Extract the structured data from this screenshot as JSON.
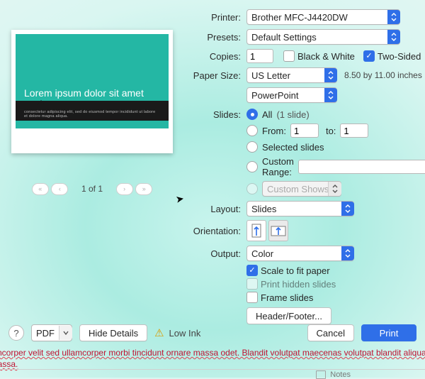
{
  "labels": {
    "printer": "Printer:",
    "presets": "Presets:",
    "copies": "Copies:",
    "paperSize": "Paper Size:",
    "slides": "Slides:",
    "layout": "Layout:",
    "orientation": "Orientation:",
    "output": "Output:"
  },
  "printer": {
    "value": "Brother MFC-J4420DW"
  },
  "presets": {
    "value": "Default Settings"
  },
  "copies": {
    "value": "1",
    "bw": {
      "label": "Black & White",
      "checked": false
    },
    "twoSided": {
      "label": "Two-Sided",
      "checked": true
    }
  },
  "paperSize": {
    "value": "US Letter",
    "dims": "8.50 by 11.00 inches"
  },
  "app": {
    "value": "PowerPoint"
  },
  "slides": {
    "all": {
      "label": "All",
      "count": "(1 slide)"
    },
    "from": {
      "label": "From:",
      "start": "1",
      "toLabel": "to:",
      "end": "1"
    },
    "selected": {
      "label": "Selected slides"
    },
    "custom": {
      "label": "Custom Range:",
      "value": ""
    },
    "shows": {
      "label": "Custom Shows"
    }
  },
  "layout": {
    "value": "Slides"
  },
  "output": {
    "value": "Color",
    "scale": {
      "label": "Scale to fit paper",
      "checked": true
    },
    "hidden": {
      "label": "Print hidden slides",
      "checked": false
    },
    "frame": {
      "label": "Frame slides",
      "checked": false
    }
  },
  "headerFooter": {
    "label": "Header/Footer..."
  },
  "preview": {
    "title": "Lorem ipsum dolor sit amet",
    "subtitle": "consectetur adipiscing elit, sed do eiusmod tempor incididunt ut labore et dolore magna aliqua.",
    "page": "1 of 1"
  },
  "bottom": {
    "help": "?",
    "pdf": "PDF",
    "hide": "Hide Details",
    "lowInk": "Low Ink",
    "cancel": "Cancel",
    "print": "Print"
  },
  "doc": {
    "line1": "us ullamcorper velit sed ullamcorper morbi tincidunt ornare massa odet. Blandit volutpat maecenas volutpat blandit aliquam etiam.",
    "line2": "us in massa."
  },
  "status": {
    "notes": "Notes"
  }
}
